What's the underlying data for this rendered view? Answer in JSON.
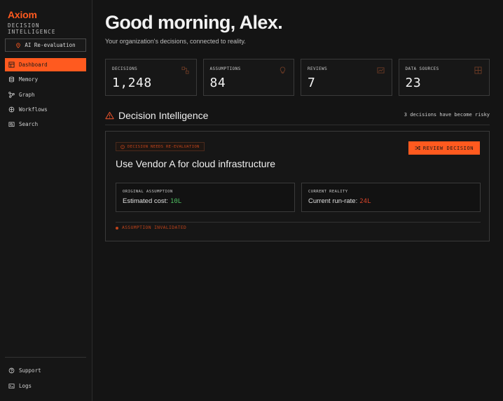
{
  "sidebar": {
    "brand": "Axiom",
    "brand_sub": "DECISION INTELLIGENCE",
    "reeval_label": "AI Re-evaluation",
    "nav": [
      {
        "label": "Dashboard",
        "icon": "dashboard-icon",
        "active": true
      },
      {
        "label": "Memory",
        "icon": "database-icon"
      },
      {
        "label": "Graph",
        "icon": "graph-icon"
      },
      {
        "label": "Workflows",
        "icon": "workflow-icon"
      },
      {
        "label": "Search",
        "icon": "search-icon"
      }
    ],
    "bottom_nav": [
      {
        "label": "Support",
        "icon": "help-icon"
      },
      {
        "label": "Logs",
        "icon": "logs-icon"
      }
    ]
  },
  "header": {
    "greeting": "Good morning, Alex.",
    "subtitle": "Your organization's decisions, connected to reality."
  },
  "stats": [
    {
      "label": "DECISIONS",
      "value": "1,248",
      "icon": "network-icon"
    },
    {
      "label": "ASSUMPTIONS",
      "value": "84",
      "icon": "lightbulb-icon"
    },
    {
      "label": "REVIEWS",
      "value": "7",
      "icon": "chart-icon"
    },
    {
      "label": "DATA SOURCES",
      "value": "23",
      "icon": "grid-icon"
    }
  ],
  "section": {
    "title": "Decision Intelligence",
    "note": "3 decisions have become risky"
  },
  "card": {
    "badge": "DECISION NEEDS RE-EVALUATION",
    "review_label": "REVIEW DECISION",
    "title": "Use Vendor A for cloud infrastructure",
    "original": {
      "label": "ORIGINAL ASSUMPTION",
      "text": "Estimated cost:",
      "value": "10L"
    },
    "current": {
      "label": "CURRENT REALITY",
      "text": "Current run-rate:",
      "value": "24L"
    },
    "status": "ASSUMPTION INVALIDATED"
  },
  "colors": {
    "accent": "#ff5a1f",
    "positive": "#4fbf62",
    "negative": "#d9452a",
    "background": "#141414"
  }
}
